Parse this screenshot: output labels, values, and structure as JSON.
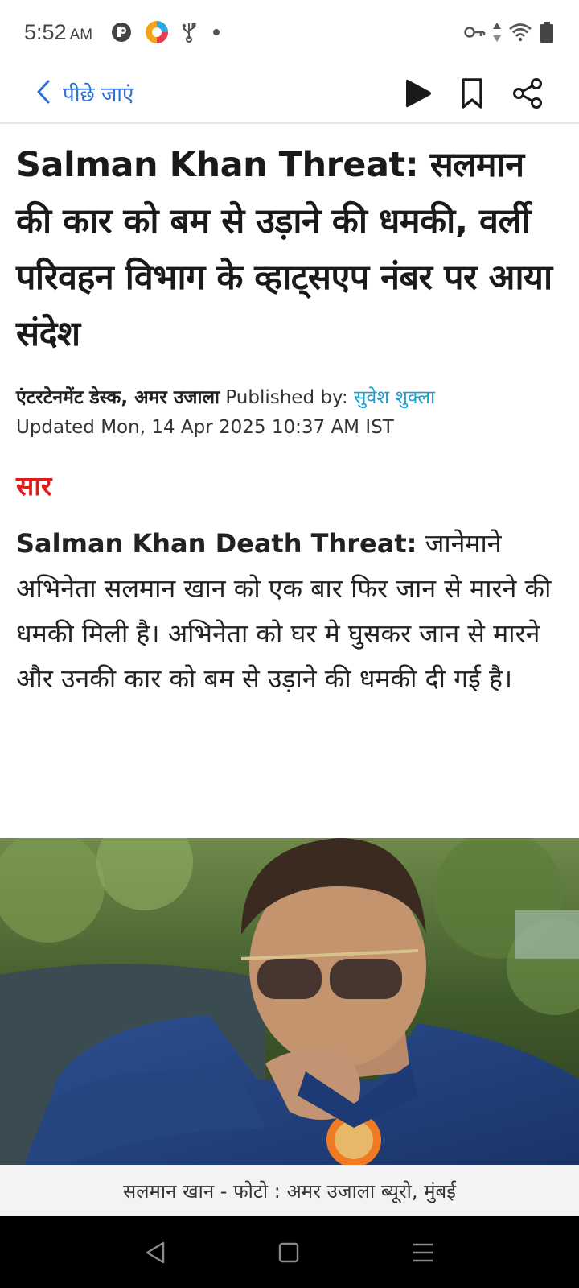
{
  "status_bar": {
    "time": "5:52",
    "ampm": "AM",
    "icons": [
      "pocket-app-icon",
      "colorful-app-icon",
      "usb-icon",
      "dot-icon",
      "vpn-key-icon",
      "data-arrows-icon",
      "wifi-icon",
      "battery-icon"
    ]
  },
  "top_nav": {
    "back_label": "पीछे जाएं",
    "actions": [
      "play-icon",
      "bookmark-icon",
      "share-icon"
    ]
  },
  "article": {
    "headline": "Salman Khan Threat: सलमान की कार को बम से उड़ाने की धमकी, वर्ली परिवहन विभाग के व्हाट्सएप नंबर पर आया संदेश",
    "desk": "एंटरटेनमेंट डेस्क, अमर उजाला",
    "published_by_label": "Published by:",
    "author": "सुवेश शुक्ला",
    "updated": "Updated Mon, 14 Apr 2025 10:37 AM IST",
    "summary_heading": "सार",
    "summary_lead": "Salman Khan Death Threat:",
    "summary_text": "जानेमाने अभिनेता सलमान खान को एक बार फिर जान से मारने की धमकी मिली है। अभिनेता को घर मे घुसकर जान से मारने और उनकी कार को बम से उड़ाने की धमकी दी गई है।"
  },
  "photo": {
    "caption": "सलमान खान - फोटो : अमर उजाला ब्यूरो, मुंबई"
  },
  "colors": {
    "accent_blue": "#2d6fd8",
    "author_blue": "#1a9fd0",
    "summary_red": "#e01d1d"
  }
}
